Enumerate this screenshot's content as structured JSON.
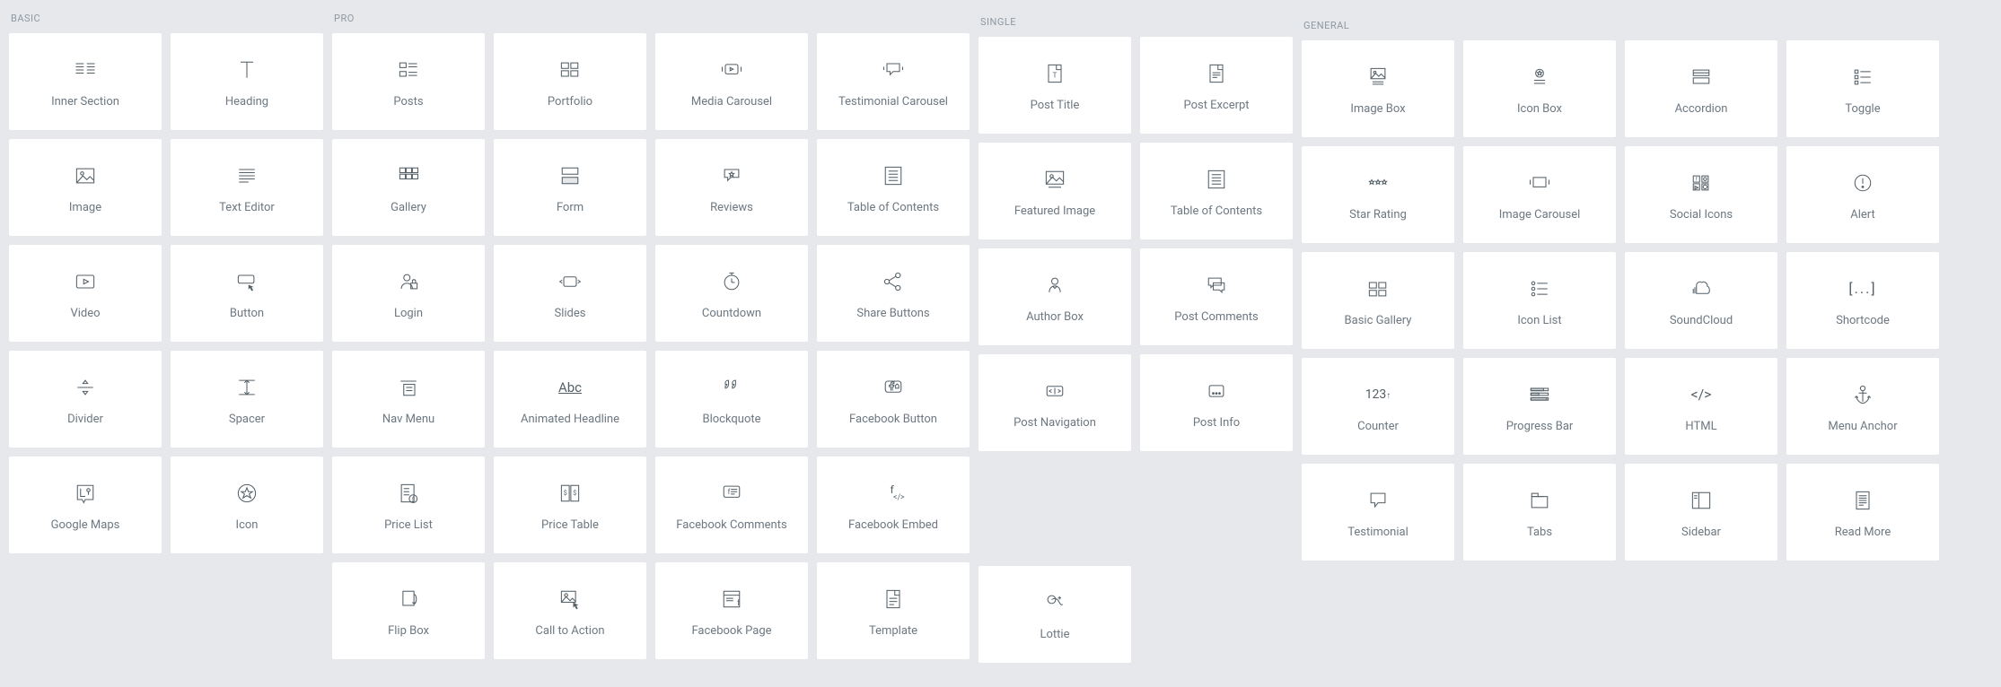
{
  "sections": {
    "basic": {
      "header": "BASIC",
      "widgets": [
        {
          "label": "Inner Section",
          "icon": "inner-section"
        },
        {
          "label": "Heading",
          "icon": "heading"
        },
        {
          "label": "Image",
          "icon": "image"
        },
        {
          "label": "Text Editor",
          "icon": "text-editor"
        },
        {
          "label": "Video",
          "icon": "video"
        },
        {
          "label": "Button",
          "icon": "button"
        },
        {
          "label": "Divider",
          "icon": "divider"
        },
        {
          "label": "Spacer",
          "icon": "spacer"
        },
        {
          "label": "Google Maps",
          "icon": "google-maps"
        },
        {
          "label": "Icon",
          "icon": "icon"
        }
      ]
    },
    "pro": {
      "header": "PRO",
      "widgets": [
        {
          "label": "Posts",
          "icon": "posts"
        },
        {
          "label": "Portfolio",
          "icon": "portfolio"
        },
        {
          "label": "Media Carousel",
          "icon": "media-carousel"
        },
        {
          "label": "Testimonial Carousel",
          "icon": "testimonial-carousel"
        },
        {
          "label": "Gallery",
          "icon": "gallery"
        },
        {
          "label": "Form",
          "icon": "form"
        },
        {
          "label": "Reviews",
          "icon": "reviews"
        },
        {
          "label": "Table of Contents",
          "icon": "toc"
        },
        {
          "label": "Login",
          "icon": "login"
        },
        {
          "label": "Slides",
          "icon": "slides"
        },
        {
          "label": "Countdown",
          "icon": "countdown"
        },
        {
          "label": "Share Buttons",
          "icon": "share"
        },
        {
          "label": "Nav Menu",
          "icon": "nav-menu"
        },
        {
          "label": "Animated Headline",
          "icon": "animated-headline"
        },
        {
          "label": "Blockquote",
          "icon": "blockquote"
        },
        {
          "label": "Facebook Button",
          "icon": "fb-button"
        },
        {
          "label": "Price List",
          "icon": "price-list"
        },
        {
          "label": "Price Table",
          "icon": "price-table"
        },
        {
          "label": "Facebook Comments",
          "icon": "fb-comments"
        },
        {
          "label": "Facebook Embed",
          "icon": "fb-embed"
        },
        {
          "label": "Flip Box",
          "icon": "flip-box"
        },
        {
          "label": "Call to Action",
          "icon": "cta"
        },
        {
          "label": "Facebook Page",
          "icon": "fb-page"
        },
        {
          "label": "Template",
          "icon": "template"
        }
      ]
    },
    "single": {
      "header": "SINGLE",
      "widgets": [
        {
          "label": "Post Title",
          "icon": "post-title"
        },
        {
          "label": "Post Excerpt",
          "icon": "post-excerpt"
        },
        {
          "label": "Featured Image",
          "icon": "featured-image"
        },
        {
          "label": "Table of Contents",
          "icon": "toc"
        },
        {
          "label": "Author Box",
          "icon": "author-box"
        },
        {
          "label": "Post Comments",
          "icon": "post-comments"
        },
        {
          "label": "Post Navigation",
          "icon": "post-nav"
        },
        {
          "label": "Post Info",
          "icon": "post-info"
        },
        {
          "label": "Lottie",
          "icon": "lottie"
        }
      ]
    },
    "general": {
      "header": "GENERAL",
      "widgets": [
        {
          "label": "Image Box",
          "icon": "image-box"
        },
        {
          "label": "Icon Box",
          "icon": "icon-box"
        },
        {
          "label": "Accordion",
          "icon": "accordion"
        },
        {
          "label": "Toggle",
          "icon": "toggle"
        },
        {
          "label": "Star Rating",
          "icon": "star-rating"
        },
        {
          "label": "Image Carousel",
          "icon": "image-carousel"
        },
        {
          "label": "Social Icons",
          "icon": "social-icons"
        },
        {
          "label": "Alert",
          "icon": "alert"
        },
        {
          "label": "Basic Gallery",
          "icon": "basic-gallery"
        },
        {
          "label": "Icon List",
          "icon": "icon-list"
        },
        {
          "label": "SoundCloud",
          "icon": "soundcloud"
        },
        {
          "label": "Shortcode",
          "icon": "shortcode"
        },
        {
          "label": "Counter",
          "icon": "counter"
        },
        {
          "label": "Progress Bar",
          "icon": "progress-bar"
        },
        {
          "label": "HTML",
          "icon": "html"
        },
        {
          "label": "Menu Anchor",
          "icon": "anchor"
        },
        {
          "label": "Testimonial",
          "icon": "testimonial"
        },
        {
          "label": "Tabs",
          "icon": "tabs"
        },
        {
          "label": "Sidebar",
          "icon": "sidebar"
        },
        {
          "label": "Read More",
          "icon": "read-more"
        }
      ]
    }
  }
}
